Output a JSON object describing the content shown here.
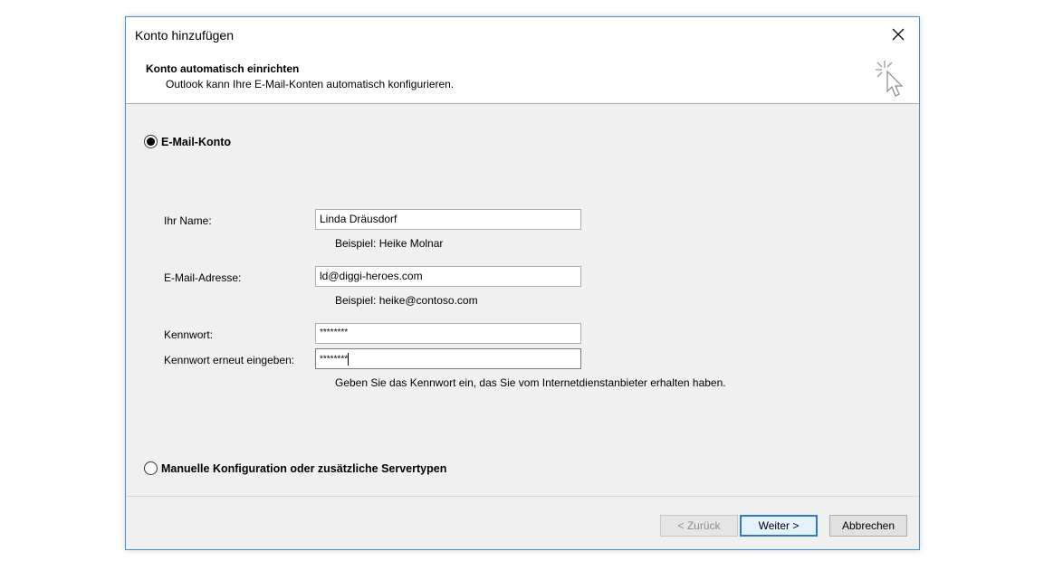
{
  "dialog": {
    "title": "Konto hinzufügen",
    "close_icon": "close-icon"
  },
  "header": {
    "title": "Konto automatisch einrichten",
    "subtitle": "Outlook kann Ihre E-Mail-Konten automatisch konfigurieren.",
    "icon": "cursor-click-icon"
  },
  "options": {
    "email_account": {
      "label": "E-Mail-Konto",
      "selected": true
    },
    "manual_config": {
      "label": "Manuelle Konfiguration oder zusätzliche Servertypen",
      "selected": false
    }
  },
  "form": {
    "name": {
      "label": "Ihr Name:",
      "value": "Linda Dräusdorf",
      "hint": "Beispiel: Heike Molnar"
    },
    "email": {
      "label": "E-Mail-Adresse:",
      "value": "ld@diggi-heroes.com",
      "hint": "Beispiel: heike@contoso.com"
    },
    "password": {
      "label": "Kennwort:",
      "value": "********"
    },
    "password_repeat": {
      "label": "Kennwort erneut eingeben:",
      "value": "********"
    },
    "password_hint": "Geben Sie das Kennwort ein, das Sie vom Internetdienstanbieter erhalten haben."
  },
  "buttons": {
    "back": "< Zurück",
    "next": "Weiter >",
    "cancel": "Abbrechen"
  },
  "colors": {
    "accent": "#2e79c8",
    "window_border": "#4a8fd0",
    "dialog_bg": "#f0f0f0"
  }
}
